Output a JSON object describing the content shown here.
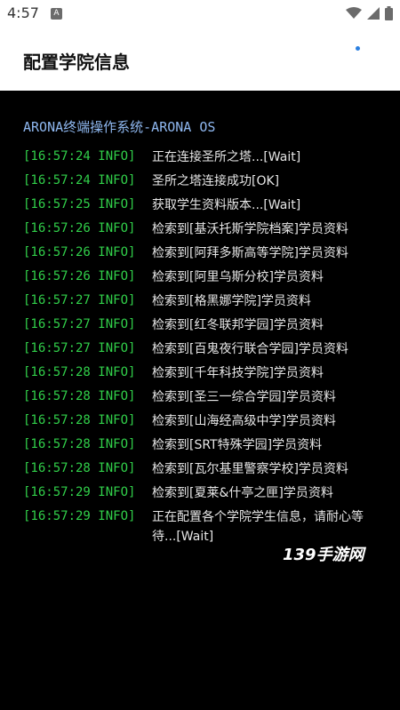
{
  "status_bar": {
    "time": "4:57",
    "notification_letter": "A"
  },
  "app_bar": {
    "title": "配置学院信息"
  },
  "console": {
    "title": "ARONA终端操作系统-ARONA OS",
    "logs": [
      {
        "ts": "[16:57:24 INFO]",
        "msg": "正在连接圣所之塔...[Wait]"
      },
      {
        "ts": "[16:57:24 INFO]",
        "msg": "圣所之塔连接成功[OK]"
      },
      {
        "ts": "[16:57:25 INFO]",
        "msg": "获取学生资料版本...[Wait]"
      },
      {
        "ts": "[16:57:26 INFO]",
        "msg": "检索到[基沃托斯学院档案]学员资料"
      },
      {
        "ts": "[16:57:26 INFO]",
        "msg": "检索到[阿拜多斯高等学院]学员资料"
      },
      {
        "ts": "[16:57:26 INFO]",
        "msg": "检索到[阿里乌斯分校]学员资料"
      },
      {
        "ts": "[16:57:27 INFO]",
        "msg": "检索到[格黑娜学院]学员资料"
      },
      {
        "ts": "[16:57:27 INFO]",
        "msg": "检索到[红冬联邦学园]学员资料"
      },
      {
        "ts": "[16:57:27 INFO]",
        "msg": "检索到[百鬼夜行联合学园]学员资料"
      },
      {
        "ts": "[16:57:28 INFO]",
        "msg": "检索到[千年科技学院]学员资料"
      },
      {
        "ts": "[16:57:28 INFO]",
        "msg": "检索到[圣三一综合学园]学员资料"
      },
      {
        "ts": "[16:57:28 INFO]",
        "msg": "检索到[山海经高级中学]学员资料"
      },
      {
        "ts": "[16:57:28 INFO]",
        "msg": "检索到[SRT特殊学园]学员资料"
      },
      {
        "ts": "[16:57:28 INFO]",
        "msg": "检索到[瓦尔基里警察学校]学员资料"
      },
      {
        "ts": "[16:57:29 INFO]",
        "msg": "检索到[夏莱&什亭之匣]学员资料"
      },
      {
        "ts": "[16:57:29 INFO]",
        "msg": "正在配置各个学院学生信息，请耐心等待...[Wait]"
      }
    ]
  },
  "watermark": "139手游网",
  "colors": {
    "log_timestamp": "#31d04a",
    "console_title": "#8fb8f0",
    "console_bg": "#000000"
  },
  "icons": [
    "wifi-icon",
    "signal-icon",
    "battery-icon"
  ]
}
